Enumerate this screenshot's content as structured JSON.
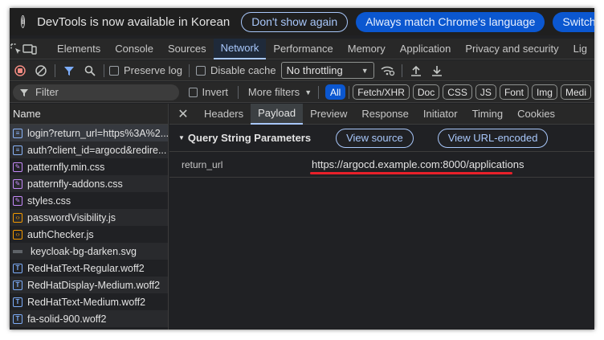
{
  "infobar": {
    "message": "DevTools is now available in Korean",
    "dont_show": "Don't show again",
    "match_language": "Always match Chrome's language",
    "switch_devtools": "Switch DevTools to"
  },
  "tabs": [
    "Elements",
    "Console",
    "Sources",
    "Network",
    "Performance",
    "Memory",
    "Application",
    "Privacy and security",
    "Lig"
  ],
  "active_tab": "Network",
  "toolbar": {
    "preserve_log": "Preserve log",
    "disable_cache": "Disable cache",
    "throttling": "No throttling"
  },
  "filterbar": {
    "placeholder": "Filter",
    "invert": "Invert",
    "more_filters": "More filters",
    "types": [
      "All",
      "Fetch/XHR",
      "Doc",
      "CSS",
      "JS",
      "Font",
      "Img",
      "Medi"
    ]
  },
  "requests": {
    "header": "Name",
    "items": [
      {
        "name": "login?return_url=https%3A%2...",
        "type": "doc",
        "selected": true
      },
      {
        "name": "auth?client_id=argocd&redire...",
        "type": "doc"
      },
      {
        "name": "patternfly.min.css",
        "type": "css"
      },
      {
        "name": "patternfly-addons.css",
        "type": "css"
      },
      {
        "name": "styles.css",
        "type": "css"
      },
      {
        "name": "passwordVisibility.js",
        "type": "js"
      },
      {
        "name": "authChecker.js",
        "type": "js"
      },
      {
        "name": "keycloak-bg-darken.svg",
        "type": "img"
      },
      {
        "name": "RedHatText-Regular.woff2",
        "type": "font"
      },
      {
        "name": "RedHatDisplay-Medium.woff2",
        "type": "font"
      },
      {
        "name": "RedHatText-Medium.woff2",
        "type": "font"
      },
      {
        "name": "fa-solid-900.woff2",
        "type": "font"
      }
    ]
  },
  "detail_tabs": [
    "Headers",
    "Payload",
    "Preview",
    "Response",
    "Initiator",
    "Timing",
    "Cookies"
  ],
  "active_detail_tab": "Payload",
  "payload": {
    "section_title": "Query String Parameters",
    "view_source": "View source",
    "view_url_encoded": "View URL-encoded",
    "param_key": "return_url",
    "param_value": "https://argocd.example.com:8000/applications"
  },
  "colors": {
    "accent": "#a8c7fa",
    "highlight_line": "#e8202a",
    "pill_filled": "#0b57d0"
  }
}
